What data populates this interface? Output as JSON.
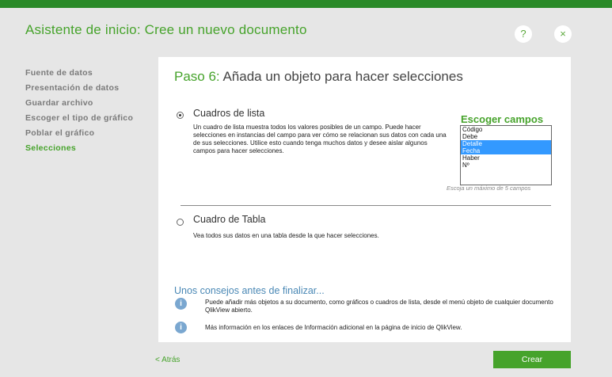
{
  "window": {
    "title": "Asistente de inicio: Cree un nuevo documento",
    "help_label": "?",
    "close_label": "×"
  },
  "sidebar": {
    "items": [
      {
        "label": "Fuente de datos",
        "active": false
      },
      {
        "label": "Presentación de datos",
        "active": false
      },
      {
        "label": "Guardar archivo",
        "active": false
      },
      {
        "label": "Escoger el tipo de gráfico",
        "active": false
      },
      {
        "label": "Poblar el gráfico",
        "active": false
      },
      {
        "label": "Selecciones",
        "active": true
      }
    ]
  },
  "step": {
    "number": "Paso 6:",
    "title": "Añada un objeto para hacer selecciones"
  },
  "options": {
    "listbox": {
      "label": "Cuadros de lista",
      "selected": true,
      "description": "Un cuadro de lista muestra todos los valores posibles de un campo. Puede hacer selecciones en instancias del campo para ver cómo se relacionan sus datos con cada una de sus selecciones. Utilice esto cuando tenga muchos datos y desee aislar algunos campos para hacer selecciones."
    },
    "table": {
      "label": "Cuadro de Tabla",
      "selected": false,
      "description": "Vea todos sus datos en una tabla desde la que hacer selecciones."
    }
  },
  "fields": {
    "title": "Escoger campos",
    "items": [
      {
        "label": "Código",
        "selected": false
      },
      {
        "label": "Debe",
        "selected": false
      },
      {
        "label": "Detalle",
        "selected": true
      },
      {
        "label": "Fecha",
        "selected": true
      },
      {
        "label": "Haber",
        "selected": false
      },
      {
        "label": "Nº",
        "selected": false
      }
    ],
    "note": "Escoja un máximo de 5 campos"
  },
  "tips": {
    "title": "Unos consejos antes de finalizar...",
    "items": [
      "Puede añadir más objetos a su documento, como gráficos o cuadros de lista, desde el menú objeto de cualquier documento QlikView abierto.",
      "Más información en los enlaces de Información adicional en la página de inicio de QlikView."
    ]
  },
  "footer": {
    "back_label": "< Atrás",
    "create_label": "Crear"
  },
  "colors": {
    "accent_green": "#46a32b",
    "top_bar": "#2a8a28",
    "selection_blue": "#3399ff",
    "tips_blue": "#4a88b5"
  }
}
